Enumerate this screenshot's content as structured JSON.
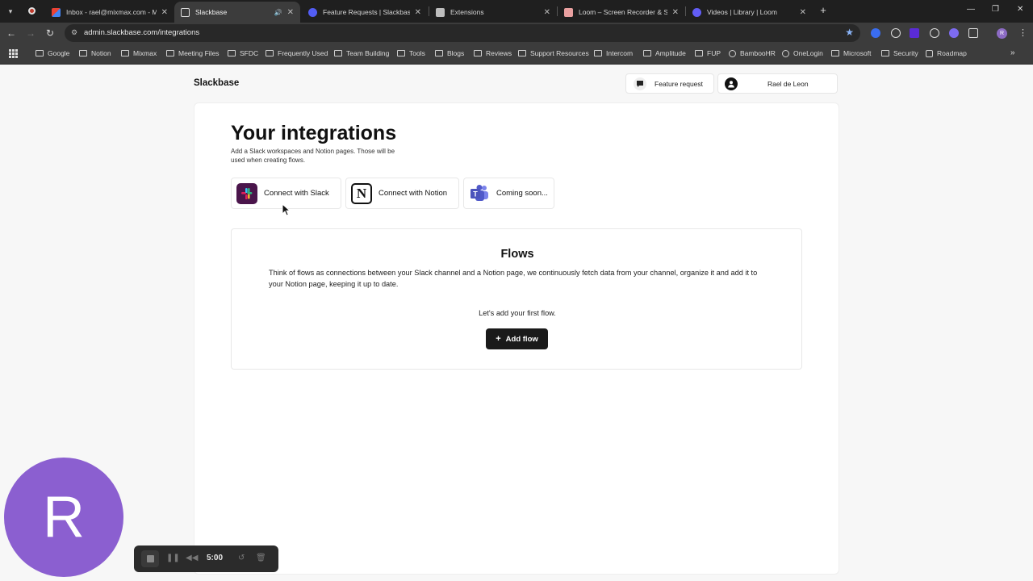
{
  "browser": {
    "tabs": [
      {
        "title": "Inbox - rael@mixmax.com - Mi",
        "icon": "gmail-icon",
        "active": false
      },
      {
        "title": "Slackbase",
        "icon": "slackbase-icon",
        "active": true
      },
      {
        "title": "Feature Requests | Slackbase",
        "icon": "canny-icon",
        "active": false
      },
      {
        "title": "Extensions",
        "icon": "puzzle-icon",
        "active": false
      },
      {
        "title": "Loom – Screen Recorder & Scre",
        "icon": "loom-icon",
        "active": false
      },
      {
        "title": "Videos | Library | Loom",
        "icon": "loom-icon",
        "active": false
      }
    ],
    "url": "admin.slackbase.com/integrations",
    "profile_initial": "R",
    "bookmarks": [
      {
        "label": "Google",
        "type": "folder"
      },
      {
        "label": "Notion",
        "type": "folder"
      },
      {
        "label": "Mixmax",
        "type": "folder"
      },
      {
        "label": "Meeting Files",
        "type": "folder"
      },
      {
        "label": "SFDC",
        "type": "folder"
      },
      {
        "label": "Frequently Used",
        "type": "folder"
      },
      {
        "label": "Team Building",
        "type": "folder"
      },
      {
        "label": "Tools",
        "type": "folder"
      },
      {
        "label": "Blogs",
        "type": "folder"
      },
      {
        "label": "Reviews",
        "type": "folder"
      },
      {
        "label": "Support Resources",
        "type": "folder"
      },
      {
        "label": "Intercom",
        "type": "folder"
      },
      {
        "label": "Amplitude",
        "type": "folder"
      },
      {
        "label": "FUP",
        "type": "folder"
      },
      {
        "label": "BambooHR",
        "type": "link"
      },
      {
        "label": "OneLogin",
        "type": "link"
      },
      {
        "label": "Microsoft",
        "type": "folder"
      },
      {
        "label": "Security",
        "type": "folder"
      },
      {
        "label": "Roadmap",
        "type": "link"
      }
    ]
  },
  "header": {
    "brand": "Slackbase",
    "feature_request": "Feature request",
    "user_name": "Rael de Leon"
  },
  "integrations": {
    "title": "Your integrations",
    "subtitle": "Add a Slack workspaces and Notion pages. Those will be used when creating flows.",
    "buttons": [
      {
        "label": "Connect with Slack",
        "icon": "slack-icon"
      },
      {
        "label": "Connect with Notion",
        "icon": "notion-icon"
      },
      {
        "label": "Coming soon...",
        "icon": "teams-icon"
      }
    ]
  },
  "flows": {
    "title": "Flows",
    "description": "Think of flows as connections between your Slack channel and a Notion page, we continuously fetch data from your channel, organize it and add it to your Notion page, keeping it up to date.",
    "cta_text": "Let's add your first flow.",
    "add_button": "Add flow"
  },
  "loom": {
    "avatar_initial": "R",
    "timer": "5:00"
  }
}
